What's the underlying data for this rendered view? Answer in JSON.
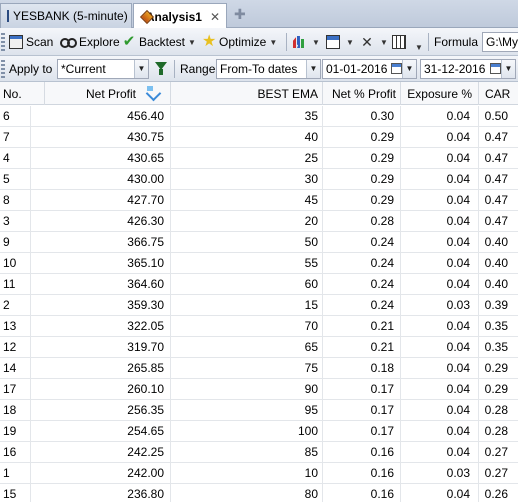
{
  "tabs": [
    {
      "label": "YESBANK (5-minute)",
      "icon": "chart-icon"
    },
    {
      "label": "Analysis1",
      "icon": "diamond-icon",
      "close": "✕"
    }
  ],
  "toolbar": {
    "scan": "Scan",
    "explore": "Explore",
    "backtest": "Backtest",
    "optimize": "Optimize",
    "formula_label": "Formula",
    "formula_value": "G:\\My"
  },
  "filter": {
    "apply_to_label": "Apply to",
    "apply_to_value": "*Current",
    "range_label": "Range",
    "range_value": "From-To dates",
    "from_date": "01-01-2016",
    "to_date": "31-12-2016"
  },
  "columns": [
    "No.",
    "Net Profit",
    "BEST EMA",
    "Net % Profit",
    "Exposure %",
    "CAR"
  ],
  "rows": [
    [
      "6",
      "456.40",
      "35",
      "0.30",
      "0.04",
      "0.50"
    ],
    [
      "7",
      "430.75",
      "40",
      "0.29",
      "0.04",
      "0.47"
    ],
    [
      "4",
      "430.65",
      "25",
      "0.29",
      "0.04",
      "0.47"
    ],
    [
      "5",
      "430.00",
      "30",
      "0.29",
      "0.04",
      "0.47"
    ],
    [
      "8",
      "427.70",
      "45",
      "0.29",
      "0.04",
      "0.47"
    ],
    [
      "3",
      "426.30",
      "20",
      "0.28",
      "0.04",
      "0.47"
    ],
    [
      "9",
      "366.75",
      "50",
      "0.24",
      "0.04",
      "0.40"
    ],
    [
      "10",
      "365.10",
      "55",
      "0.24",
      "0.04",
      "0.40"
    ],
    [
      "11",
      "364.60",
      "60",
      "0.24",
      "0.04",
      "0.40"
    ],
    [
      "2",
      "359.30",
      "15",
      "0.24",
      "0.03",
      "0.39"
    ],
    [
      "13",
      "322.05",
      "70",
      "0.21",
      "0.04",
      "0.35"
    ],
    [
      "12",
      "319.70",
      "65",
      "0.21",
      "0.04",
      "0.35"
    ],
    [
      "14",
      "265.85",
      "75",
      "0.18",
      "0.04",
      "0.29"
    ],
    [
      "17",
      "260.10",
      "90",
      "0.17",
      "0.04",
      "0.29"
    ],
    [
      "18",
      "256.35",
      "95",
      "0.17",
      "0.04",
      "0.28"
    ],
    [
      "19",
      "254.65",
      "100",
      "0.17",
      "0.04",
      "0.28"
    ],
    [
      "16",
      "242.25",
      "85",
      "0.16",
      "0.04",
      "0.27"
    ],
    [
      "1",
      "242.00",
      "10",
      "0.16",
      "0.03",
      "0.27"
    ],
    [
      "15",
      "236.80",
      "80",
      "0.16",
      "0.04",
      "0.26"
    ]
  ]
}
